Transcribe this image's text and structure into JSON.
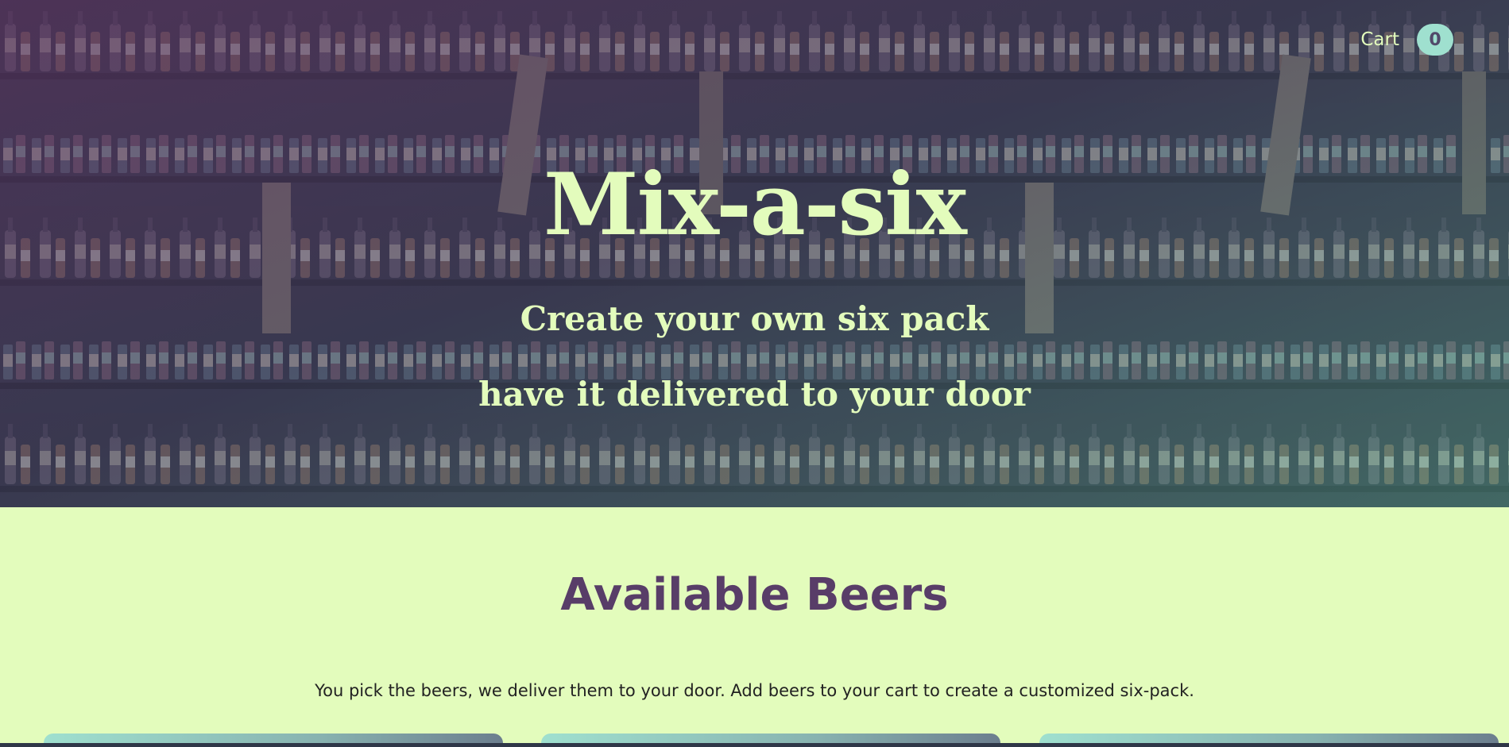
{
  "hero": {
    "title": "Mix-a-six",
    "subtitle_line1": "Create your own six pack",
    "subtitle_line2": "have it delivered to your door"
  },
  "cart": {
    "label": "Cart",
    "count": "0"
  },
  "beers_section": {
    "title": "Available Beers",
    "intro": "You pick the beers, we deliver them to your door. Add beers to your cart to create a customized six-pack."
  },
  "colors": {
    "accent_green": "#e3fcbc",
    "heading_purple": "#583d68",
    "badge_teal": "#9fe0cf"
  }
}
